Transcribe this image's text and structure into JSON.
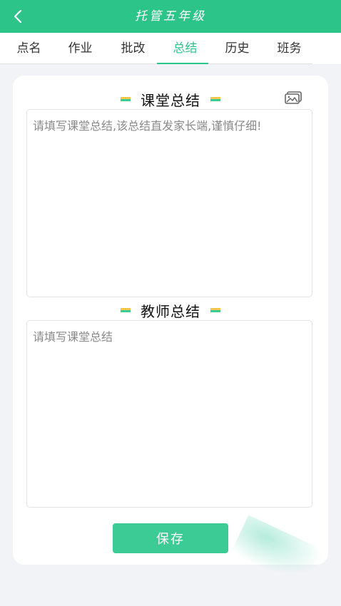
{
  "header": {
    "title": "托管五年级",
    "back_icon": "chevron-left-icon"
  },
  "tabs": [
    {
      "label": "点名",
      "active": false
    },
    {
      "label": "作业",
      "active": false
    },
    {
      "label": "批改",
      "active": false
    },
    {
      "label": "总结",
      "active": true
    },
    {
      "label": "历史",
      "active": false
    },
    {
      "label": "班务",
      "active": false
    }
  ],
  "class_summary": {
    "title": "课堂总结",
    "placeholder": "请填写课堂总结,该总结直发家长端,谨慎仔细!",
    "value": "",
    "image_icon": "image-gallery-icon"
  },
  "teacher_summary": {
    "title": "教师总结",
    "placeholder": "请填写课堂总结",
    "value": ""
  },
  "save_label": "保存",
  "colors": {
    "accent": "#2cc489",
    "button": "#3ccb94",
    "background": "#f2f3f6",
    "deco_yellow": "#f1c84b",
    "deco_green": "#3ccb94"
  }
}
